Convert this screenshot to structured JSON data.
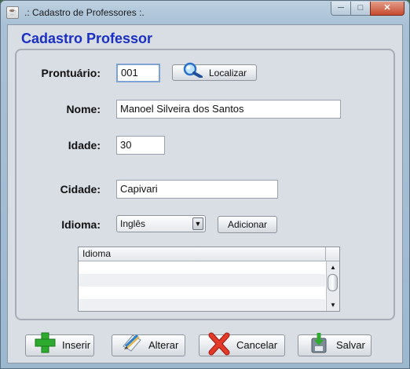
{
  "window": {
    "title": ".: Cadastro de Professores :.",
    "minimize_glyph": "─",
    "maximize_glyph": "□",
    "close_glyph": "✕"
  },
  "form": {
    "heading": "Cadastro Professor",
    "prontuario": {
      "label": "Prontuário:",
      "value": "001"
    },
    "localizar_label": "Localizar",
    "nome": {
      "label": "Nome:",
      "value": "Manoel Silveira dos Santos"
    },
    "idade": {
      "label": "Idade:",
      "value": "30"
    },
    "cidade": {
      "label": "Cidade:",
      "value": "Capivari"
    },
    "idioma": {
      "label": "Idioma:",
      "selected": "Inglês"
    },
    "adicionar_label": "Adicionar",
    "table": {
      "columns": [
        "Idioma"
      ],
      "rows": []
    }
  },
  "actions": {
    "inserir": "Inserir",
    "alterar": "Alterar",
    "cancelar": "Cancelar",
    "salvar": "Salvar"
  },
  "icons": {
    "app": "java-cup-icon",
    "localizar": "magnifier-icon",
    "inserir": "plus-icon",
    "alterar": "edit-pencil-icon",
    "cancelar": "red-x-icon",
    "salvar": "save-download-icon"
  },
  "colors": {
    "heading": "#1a2fc4",
    "plus_green": "#2eaa2e",
    "cancel_red": "#d42a1a"
  }
}
